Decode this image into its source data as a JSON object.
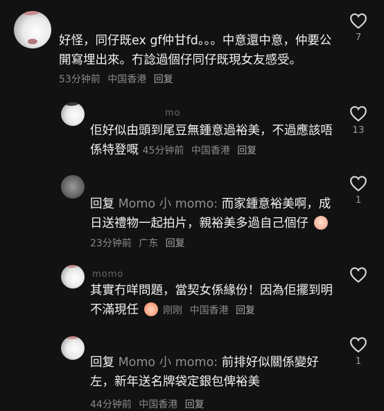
{
  "comments": [
    {
      "username": "",
      "text": "好怪，同仔既ex gf仲甘fd。。。中意還中意，仲要公開寫埋出來。冇諗過個仔同仔既現女友感受。",
      "time": "53分钟前",
      "location": "中国香港",
      "reply_label": "回复",
      "likes": "7"
    },
    {
      "username": "mo",
      "text": "佢好似由頭到尾豆無鍾意過裕美，不過應該唔係特登嘅",
      "time": "45分钟前",
      "location": "中国香港",
      "reply_label": "回复",
      "likes": "13"
    },
    {
      "username": "",
      "reply_prefix": "回复",
      "mention": "Momo 小 momo:",
      "text": "而家鍾意裕美啊，成日送禮物一起拍片，親裕美多過自己個仔",
      "emoji": "crying-emoji",
      "time": "23分钟前",
      "location": "广东",
      "reply_label": "回复",
      "likes": "1"
    },
    {
      "username": "momo",
      "text": "其實冇咩問題，當契女係緣份！因為佢擺到明不滿現任",
      "emoji": "peach-emoji",
      "time": "刚刚",
      "location": "中国香港",
      "reply_label": "回复",
      "likes": ""
    },
    {
      "username": "",
      "reply_prefix": "回复",
      "mention": "Momo 小 momo:",
      "text": "前排好似關係變好左，新年送名牌袋定銀包俾裕美",
      "time": "44分钟前",
      "location": "中国香港",
      "reply_label": "回复",
      "likes": "1"
    }
  ],
  "colors": {
    "background": "#121212",
    "text": "#f2f2f2",
    "meta": "#8a8a8a"
  }
}
